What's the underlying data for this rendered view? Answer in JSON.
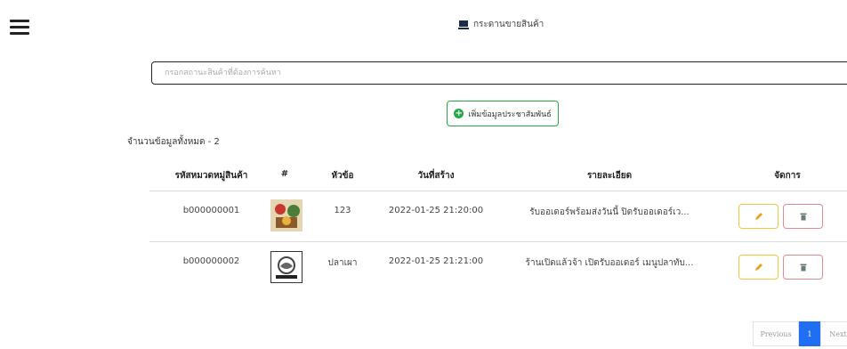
{
  "header": {
    "title": "กระดานขายสินค้า",
    "icon": "monitor-icon"
  },
  "menu": {
    "icon": "hamburger-menu-icon"
  },
  "search": {
    "placeholder": "กรอกสถานะสินค้าที่ต้องการค้นหา",
    "value": ""
  },
  "add_button": {
    "label": "เพิ่มข้อมูลประชาสัมพันธ์",
    "icon": "plus-circle-icon",
    "color": "#28a745"
  },
  "summary": {
    "count_text": "จำนวนข้อมูลทั้งหมด - 2"
  },
  "table": {
    "headers": [
      "รหัสหมวดหมู่สินค้า",
      "#",
      "หัวข้อ",
      "วันที่สร้าง",
      "รายละเอียด",
      "จัดการ"
    ],
    "rows": [
      {
        "code": "b000000001",
        "image": "product-thumbnail",
        "topic": "123",
        "created": "2022-01-25 21:20:00",
        "detail": "รับออเดอร์พร้อมส่งวันนี้ ปิดรับออเดอร์เว..."
      },
      {
        "code": "b000000002",
        "image": "product-thumbnail",
        "topic": "ปลาเผา",
        "created": "2022-01-25 21:21:00",
        "detail": "ร้านเปิดแล้วจ้า เปิดรับออเดอร์ เมนูปลาทับ..."
      }
    ],
    "actions": {
      "edit_icon": "pencil-icon",
      "delete_icon": "trash-icon",
      "edit_color": "#f5c542",
      "delete_color": "#e58a94"
    }
  },
  "pagination": {
    "previous": "Previous",
    "current": "1",
    "next": "Next",
    "accent": "#1e6ff2"
  }
}
